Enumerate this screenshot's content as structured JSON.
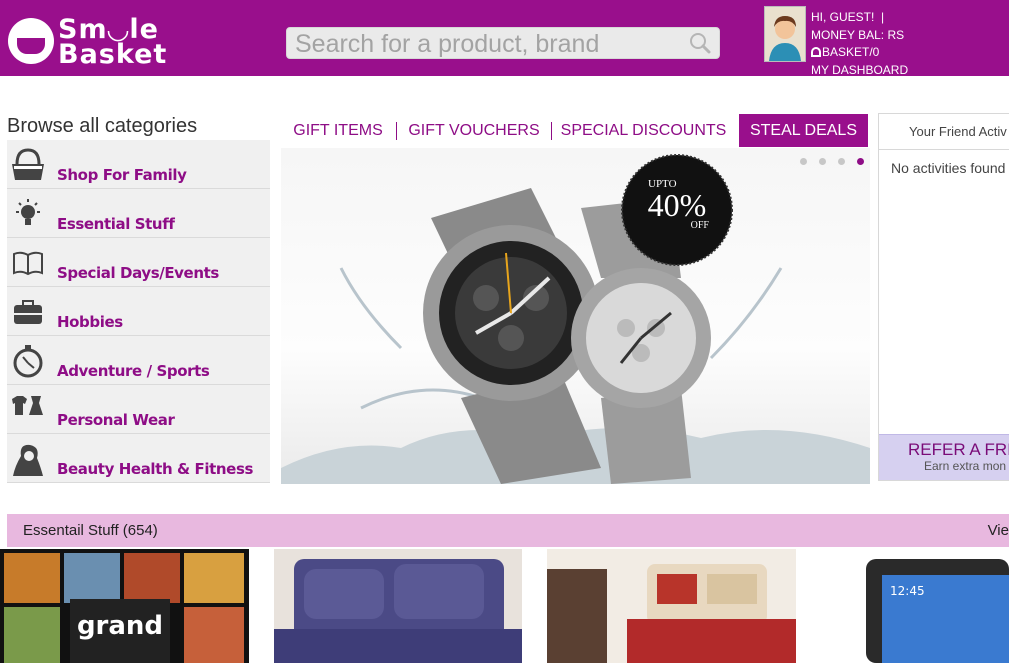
{
  "header": {
    "logo_line1": "Sm◡le",
    "logo_line2": "Basket",
    "search_placeholder": "Search for a product, brand",
    "greeting": "HI, GUEST!",
    "money": "MONEY BAL: RS",
    "basket": "BASKET/0",
    "dashboard": "MY DASHBOARD",
    "bar_color": "#990f8c"
  },
  "sidebar": {
    "title": "Browse all categories",
    "items": [
      {
        "label": "Shop For Family",
        "icon": "basket-icon"
      },
      {
        "label": "Essential Stuff",
        "icon": "bulb-icon"
      },
      {
        "label": "Special Days/Events",
        "icon": "book-icon"
      },
      {
        "label": "Hobbies",
        "icon": "briefcase-icon"
      },
      {
        "label": "Adventure / Sports",
        "icon": "stopwatch-icon"
      },
      {
        "label": "Personal Wear",
        "icon": "clothes-icon"
      },
      {
        "label": "Beauty Health & Fitness",
        "icon": "woman-icon"
      }
    ]
  },
  "tabs": [
    {
      "label": "GIFT ITEMS"
    },
    {
      "label": "GIFT VOUCHERS"
    },
    {
      "label": "SPECIAL DISCOUNTS"
    },
    {
      "label": "STEAL DEALS",
      "active": true
    }
  ],
  "banner": {
    "badge_upto": "UPTO",
    "badge_pct": "40%",
    "badge_off": "OFF",
    "slides": 4,
    "active_slide": 4
  },
  "activity": {
    "title": "Your Friend Activ",
    "empty": "No activities found",
    "refer_title": "REFER A FRIE",
    "refer_sub": "Earn extra mon"
  },
  "essentials": {
    "title": "Essentail Stuff (654)",
    "view": "Vie"
  }
}
